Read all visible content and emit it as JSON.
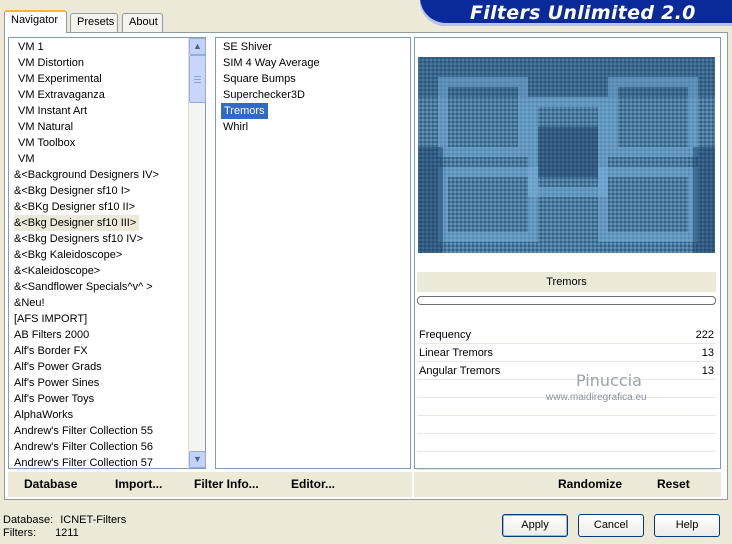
{
  "app_title": "Filters Unlimited 2.0",
  "tabs": [
    {
      "label": "Navigator",
      "active": true
    },
    {
      "label": "Presets",
      "active": false
    },
    {
      "label": "About",
      "active": false
    }
  ],
  "categories": [
    "VM 1",
    "VM Distortion",
    "VM Experimental",
    "VM Extravaganza",
    "VM Instant Art",
    "VM Natural",
    "VM Toolbox",
    "VM",
    "&<Background Designers IV>",
    "&<Bkg Designer sf10 I>",
    "&<BKg Designer sf10 II>",
    "&<Bkg Designer sf10 III>",
    "&<Bkg Designers sf10 IV>",
    "&<Bkg Kaleidoscope>",
    "&<Kaleidoscope>",
    "&<Sandflower Specials^v^ >",
    "&Neu!",
    "[AFS IMPORT]",
    "AB Filters 2000",
    "Alf's Border FX",
    "Alf's Power Grads",
    "Alf's Power Sines",
    "Alf's Power Toys",
    "AlphaWorks",
    "Andrew's Filter Collection 55",
    "Andrew's Filter Collection 56",
    "Andrew's Filter Collection 57"
  ],
  "selected_category_index": 11,
  "filters": [
    "SE Shiver",
    "SIM 4 Way Average",
    "Square Bumps",
    "Superchecker3D",
    "Tremors",
    "Whirl"
  ],
  "selected_filter_index": 4,
  "left_toolbar": {
    "database": "Database",
    "import": "Import...",
    "filter_info": "Filter Info...",
    "editor": "Editor..."
  },
  "right_toolbar": {
    "randomize": "Randomize",
    "reset": "Reset"
  },
  "filter_name": "Tremors",
  "params": [
    {
      "name": "Frequency",
      "value": "222"
    },
    {
      "name": "Linear Tremors",
      "value": "13"
    },
    {
      "name": "Angular Tremors",
      "value": "13"
    }
  ],
  "watermark": {
    "name": "Pinuccia",
    "url": "www.maidiregrafica.eu"
  },
  "status": {
    "database_label": "Database:",
    "database_value": "ICNET-Filters",
    "filters_label": "Filters:",
    "filters_value": "1211"
  },
  "buttons": {
    "apply": "Apply",
    "cancel": "Cancel",
    "help": "Help"
  },
  "colors": {
    "banner": "#0a2a9a",
    "selection": "#316ac5",
    "preview": "#3f78a6"
  }
}
